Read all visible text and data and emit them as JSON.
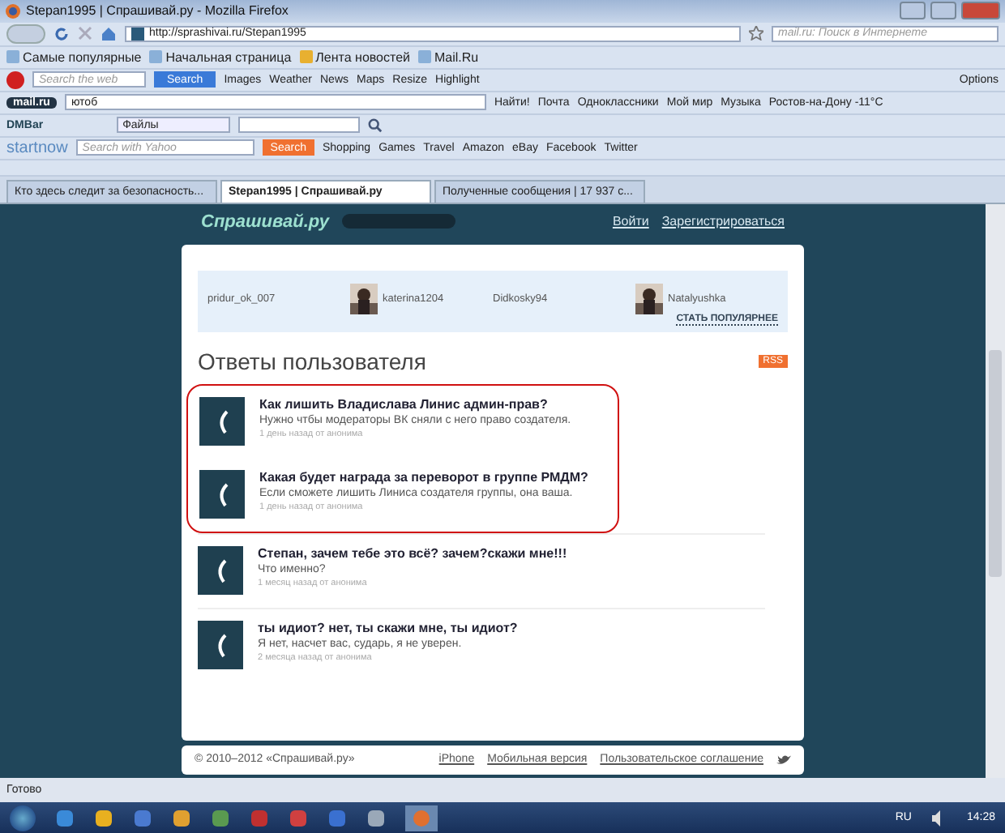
{
  "window": {
    "title": "Stepan1995 | Спрашивай.ру - Mozilla Firefox"
  },
  "nav": {
    "url": "http://sprashivai.ru/Stepan1995",
    "search_placeholder": "mail.ru: Поиск в Интернете"
  },
  "bookmarks": [
    "Самые популярные",
    "Начальная страница",
    "Лента новостей",
    "Mail.Ru"
  ],
  "ask_toolbar": {
    "placeholder": "Search the web",
    "button": "Search",
    "items": [
      "Images",
      "Weather",
      "News",
      "Maps",
      "Resize",
      "Highlight"
    ],
    "options": "Options"
  },
  "mail_toolbar": {
    "logo": "mail.ru",
    "query": "ютоб",
    "find": "Найти!",
    "items": [
      "Почта",
      "Одноклассники",
      "Мой мир",
      "Музыка",
      "Ростов-на-Дону -11°C"
    ]
  },
  "dm_toolbar": {
    "logo": "DMBar",
    "dropdown": "Файлы"
  },
  "startnow_toolbar": {
    "logo": "startnow",
    "placeholder": "Search with Yahoo",
    "button": "Search",
    "items": [
      "Shopping",
      "Games",
      "Travel",
      "Amazon",
      "eBay",
      "Facebook",
      "Twitter"
    ]
  },
  "tabs": [
    {
      "label": "Кто здесь следит за безопасность...",
      "selected": false
    },
    {
      "label": "Stepan1995 | Спрашивай.ру",
      "selected": true
    },
    {
      "label": "Полученные сообщения | 17 937 с...",
      "selected": false
    }
  ],
  "site_header": {
    "logo": "Спрашивай.ру",
    "login": "Войти",
    "register": "Зарегистрироваться"
  },
  "popular_users": [
    {
      "name": "pridur_ok_007",
      "avatar": false
    },
    {
      "name": "katerina1204",
      "avatar": true
    },
    {
      "name": "Didkosky94",
      "avatar": false
    },
    {
      "name": "Natalyushka",
      "avatar": true
    }
  ],
  "become_popular": "СТАТЬ ПОПУЛЯРНЕЕ",
  "answers_heading": "Ответы пользователя",
  "rss": "RSS",
  "answers": {
    "circled": [
      {
        "question": "Как лишить Владислава Линис админ-прав?",
        "answer": "Нужно чтбы модераторы ВК сняли с него право создателя.",
        "meta": "1 день назад от анонима"
      },
      {
        "question": "Какая будет награда за переворот в группе РМДМ?",
        "answer": "Если сможете лишить Линиса создателя группы, она ваша.",
        "meta": "1 день назад от анонима"
      }
    ],
    "others": [
      {
        "question": "Степан, зачем тебе это всё? зачем?скажи мне!!!",
        "answer": "Что именно?",
        "meta": "1 месяц назад от анонима"
      },
      {
        "question": "ты идиот? нет, ты скажи мне, ты идиот?",
        "answer": "Я нет, насчет вас, сударь, я не уверен.",
        "meta": "2 месяца назад от анонима"
      }
    ]
  },
  "footer": {
    "copyright": "© 2010–2012 «Спрашивай.ру»",
    "links": [
      "iPhone",
      "Мобильная версия",
      "Пользовательское соглашение"
    ]
  },
  "status_bar": "Готово",
  "taskbar": {
    "language": "RU",
    "time": "14:28"
  }
}
